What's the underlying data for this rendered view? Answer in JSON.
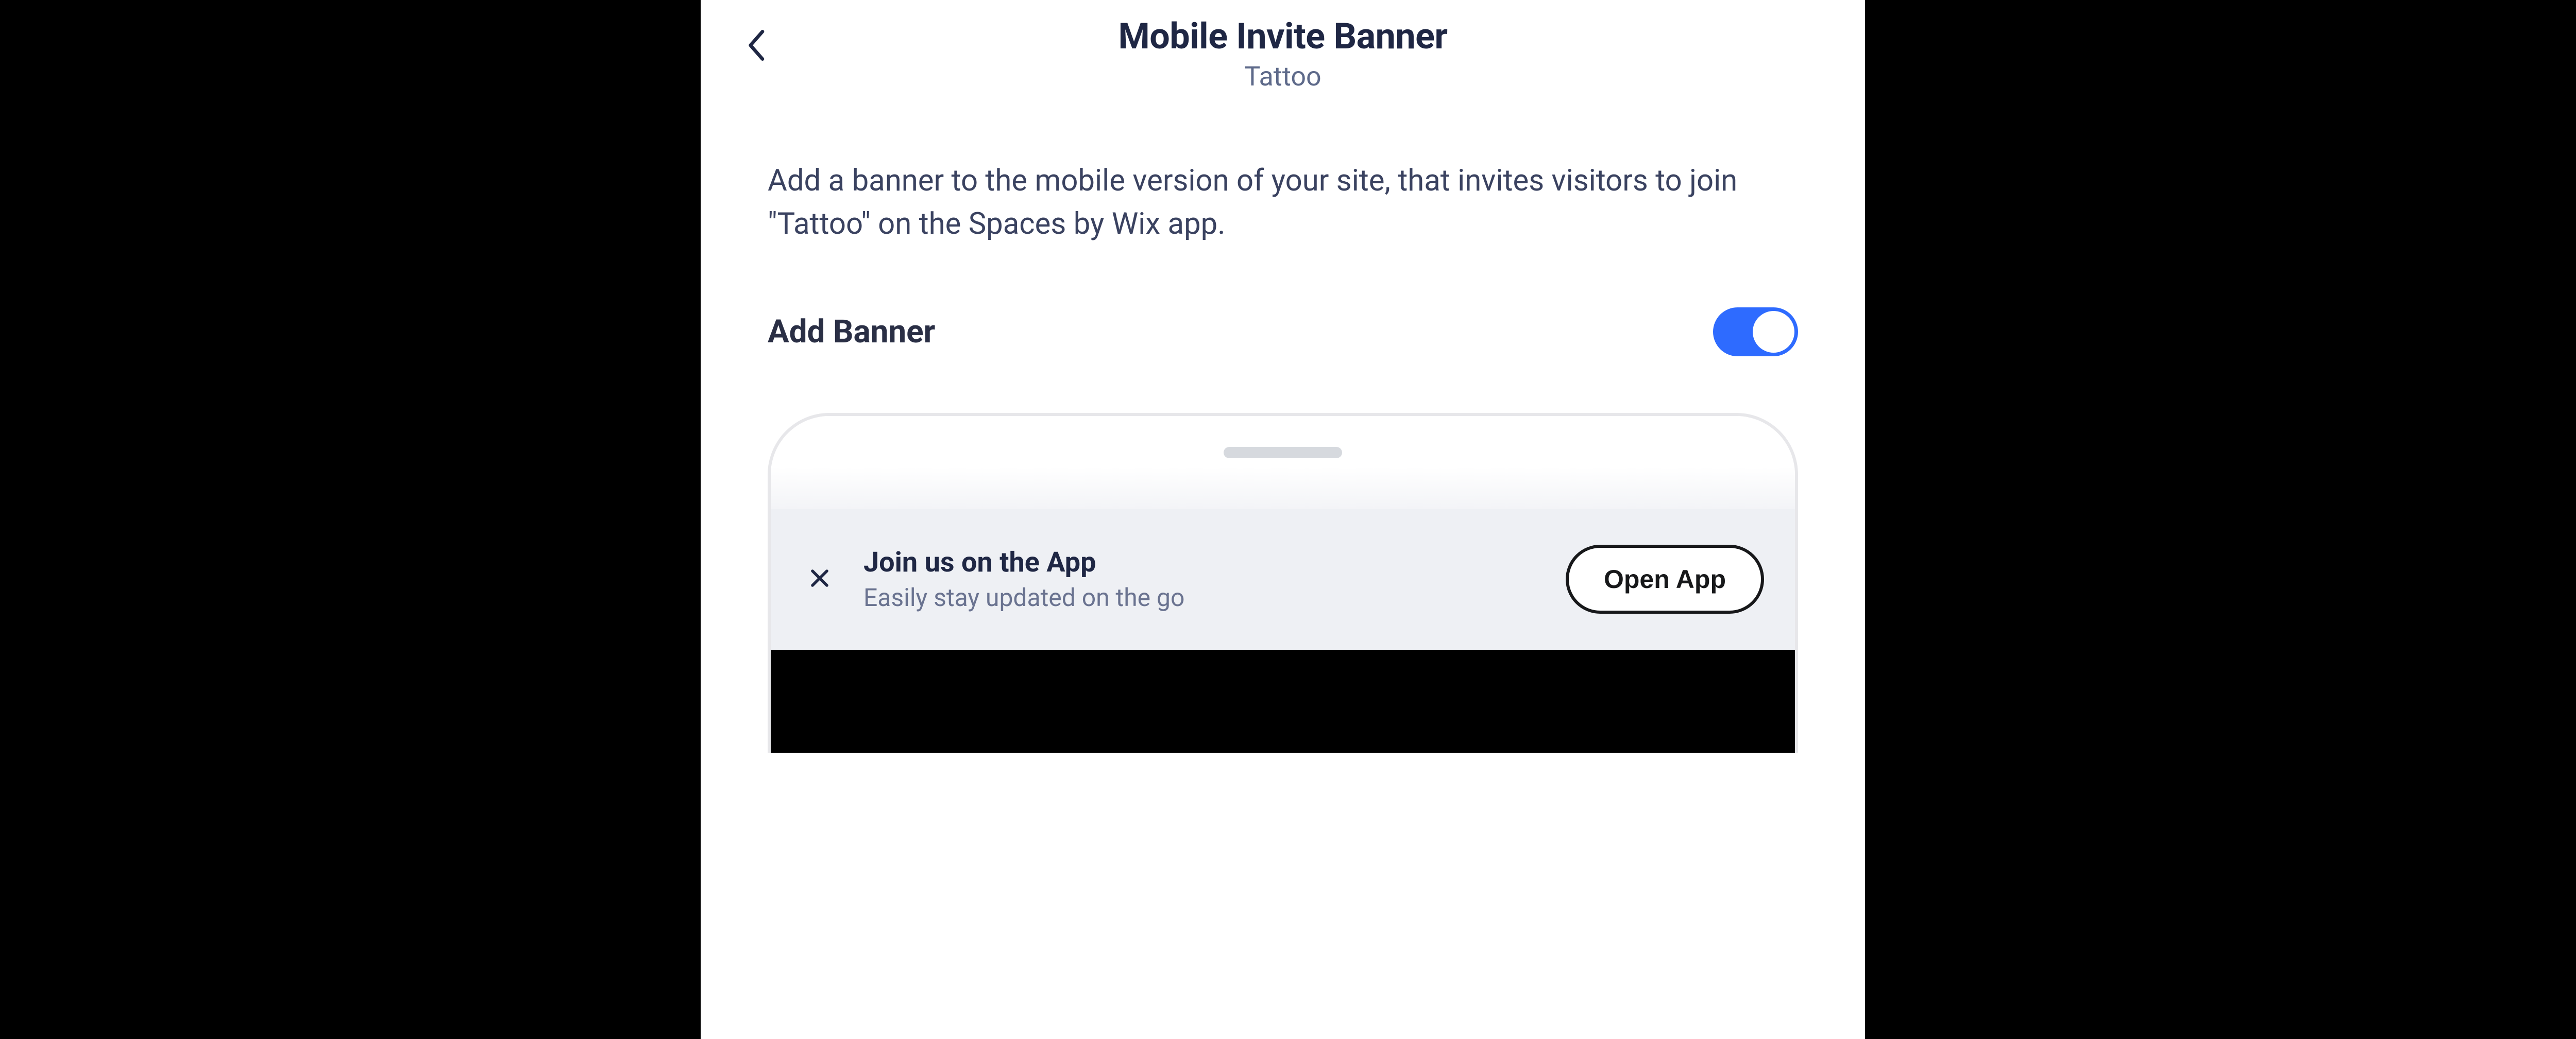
{
  "header": {
    "title": "Mobile Invite Banner",
    "subtitle": "Tattoo"
  },
  "description": "Add a banner to the mobile version of your site, that invites visitors to join \"Tattoo\" on the Spaces by Wix app.",
  "toggle": {
    "label": "Add Banner",
    "on": true
  },
  "preview_banner": {
    "title": "Join us on the App",
    "subtitle": "Easily stay updated on the go",
    "button": "Open App"
  },
  "colors": {
    "accent": "#2e6bff"
  }
}
